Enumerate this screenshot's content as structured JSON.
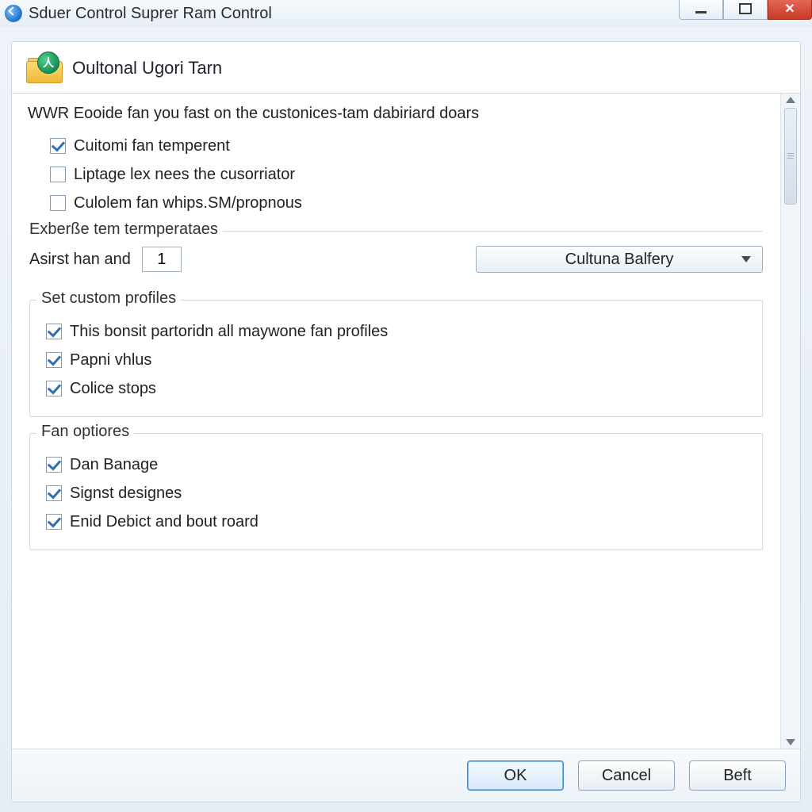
{
  "window": {
    "title": "Sduer Control Suprer Ram Control"
  },
  "header": {
    "title": "Oultonal Ugori Tarn"
  },
  "intro": "WWR Eooide fan you fast on the custonices-tam dabiriard doars",
  "top_checks": [
    {
      "label": "Cuitomi fan temperent",
      "checked": true
    },
    {
      "label": "Liptage lex nees the cusorriator",
      "checked": false
    },
    {
      "label": "Culolem fan whips.SM/propnous",
      "checked": false
    }
  ],
  "group_temp": {
    "legend": "Exberße tem termperataes",
    "field_label": "Asirst han and",
    "field_value": "1",
    "dropdown_value": "Cultuna Balfery"
  },
  "group_profiles": {
    "legend": "Set custom profiles",
    "checks": [
      {
        "label": "This bonsit partoridn all maywone fan profiles",
        "checked": true
      },
      {
        "label": "Papni vhlus",
        "checked": true
      },
      {
        "label": "Colice stops",
        "checked": true
      }
    ]
  },
  "group_fan": {
    "legend": "Fan optiores",
    "checks": [
      {
        "label": "Dan Banage",
        "checked": true
      },
      {
        "label": "Signst designes",
        "checked": true
      },
      {
        "label": "Enid Debict and bout roard",
        "checked": true
      }
    ]
  },
  "footer": {
    "ok": "OK",
    "cancel": "Cancel",
    "beft": "Beft"
  }
}
